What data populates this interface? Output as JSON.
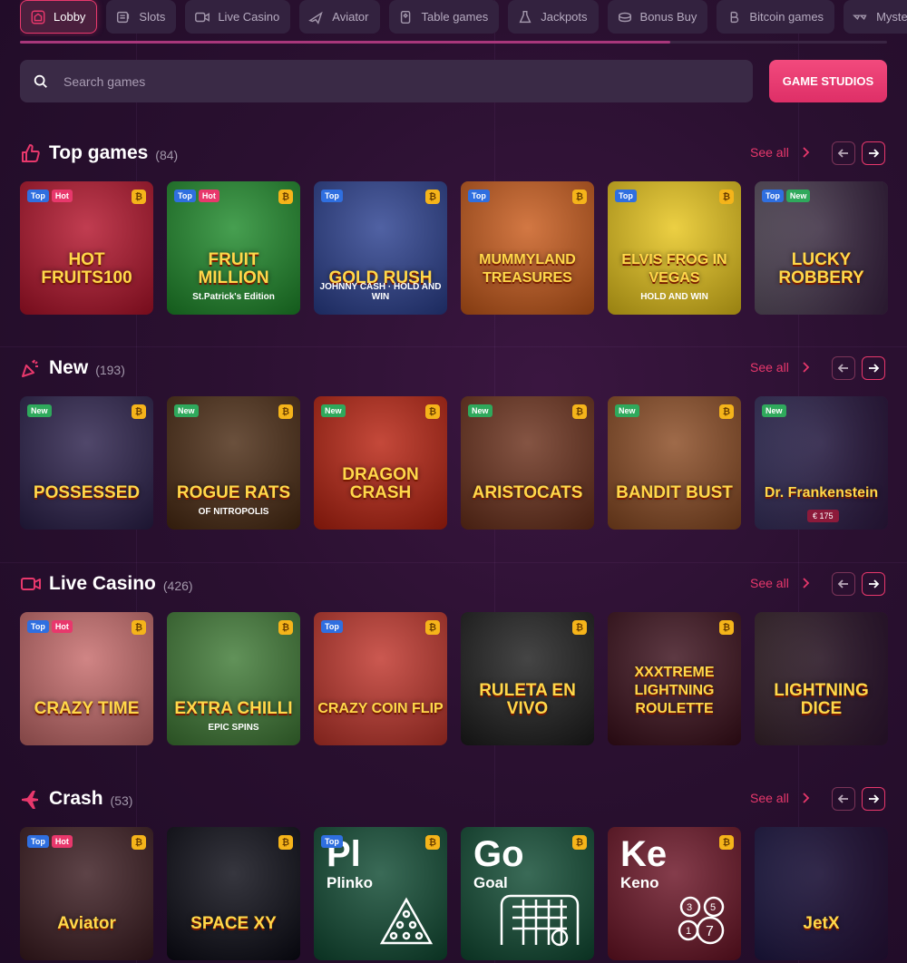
{
  "nav": {
    "tabs": [
      {
        "label": "Lobby",
        "icon": "home-icon",
        "active": true
      },
      {
        "label": "Slots",
        "icon": "slot-machine-icon"
      },
      {
        "label": "Live Casino",
        "icon": "video-camera-icon"
      },
      {
        "label": "Aviator",
        "icon": "plane-icon"
      },
      {
        "label": "Table games",
        "icon": "cards-icon"
      },
      {
        "label": "Jackpots",
        "icon": "jackpot-icon"
      },
      {
        "label": "Bonus Buy",
        "icon": "bonus-buy-icon"
      },
      {
        "label": "Bitcoin games",
        "icon": "bitcoin-icon"
      },
      {
        "label": "Mystery D",
        "icon": "mystery-icon"
      }
    ],
    "scroll_progress": 0.75
  },
  "search": {
    "placeholder": "Search games"
  },
  "studios_button": "GAME STUDIOS",
  "see_all": "See all",
  "sections": [
    {
      "title": "Top games",
      "count": "(84)",
      "icon": "thumbs-up-icon",
      "games": [
        {
          "title": "HOT FRUITS100",
          "badges": [
            "Top",
            "Hot"
          ],
          "bg": "#b3122a"
        },
        {
          "title": "FRUIT MILLION",
          "sub": "St.Patrick's Edition",
          "badges": [
            "Top",
            "Hot"
          ],
          "bg": "#1e8a2a"
        },
        {
          "title": "GOLD RUSH",
          "sub": "JOHNNY CASH · HOLD AND WIN",
          "badges": [
            "Top"
          ],
          "bg": "#2a3f8f"
        },
        {
          "title": "MUMMYLAND TREASURES",
          "badges": [
            "Top"
          ],
          "bg": "#c95a1a"
        },
        {
          "title": "ELVIS FROG IN VEGAS",
          "sub": "HOLD AND WIN",
          "badges": [
            "Top"
          ],
          "bg": "#e8c51a"
        },
        {
          "title": "LUCKY ROBBERY",
          "badges": [
            "Top",
            "New"
          ],
          "bg": "#6b6470"
        }
      ]
    },
    {
      "title": "New",
      "count": "(193)",
      "icon": "confetti-icon",
      "games": [
        {
          "title": "POSSESSED",
          "badges": [
            "New"
          ],
          "bg": "#2a1f4a"
        },
        {
          "title": "ROGUE RATS",
          "sub": "OF NITROPOLIS",
          "badges": [
            "New"
          ],
          "bg": "#4a2a12"
        },
        {
          "title": "DRAGON CRASH",
          "badges": [
            "New"
          ],
          "bg": "#b8210f"
        },
        {
          "title": "ARISTOCATS",
          "badges": [
            "New"
          ],
          "bg": "#6a2f1a"
        },
        {
          "title": "BANDIT BUST",
          "badges": [
            "New"
          ],
          "bg": "#8a4a22"
        },
        {
          "title": "Dr. Frankenstein",
          "chip": "€ 175",
          "badges": [
            "New"
          ],
          "bg": "#3a3a6a"
        }
      ]
    },
    {
      "title": "Live Casino",
      "count": "(426)",
      "icon": "video-camera-icon",
      "games": [
        {
          "title": "CRAZY TIME",
          "badges": [
            "Top",
            "Hot"
          ],
          "bg": "#c66a6a"
        },
        {
          "title": "EXTRA CHILLI",
          "sub": "EPIC SPINS",
          "badges": [],
          "bg": "#3f7a35"
        },
        {
          "title": "CRAZY COIN FLIP",
          "badges": [
            "Top"
          ],
          "bg": "#c0342a"
        },
        {
          "title": "RULETA EN VIVO",
          "badges": [],
          "bg": "#1c1c1c"
        },
        {
          "title": "XXXTREME LIGHTNING ROULETTE",
          "badges": [],
          "bg": "#3a0e1a"
        },
        {
          "title": "LIGHTNING DICE",
          "badges": [],
          "bg": "#3c2a2a"
        }
      ]
    },
    {
      "title": "Crash",
      "count": "(53)",
      "icon": "jet-icon",
      "games": [
        {
          "title": "Aviator",
          "badges": [
            "Top",
            "Hot"
          ],
          "bg": "#3a1a1f"
        },
        {
          "title": "SPACE XY",
          "badges": [],
          "bg": "#0a0a14"
        },
        {
          "abbr": "Pl",
          "name": "Plinko",
          "badges": [
            "Top"
          ],
          "bg": "#0f4a32"
        },
        {
          "abbr": "Go",
          "name": "Goal",
          "badges": [],
          "bg": "#0f4a32"
        },
        {
          "abbr": "Ke",
          "name": "Keno",
          "badges": [],
          "bg": "#6a1224"
        },
        {
          "title": "JetX",
          "badges": [],
          "bg": "#1a1a4a"
        }
      ]
    }
  ]
}
